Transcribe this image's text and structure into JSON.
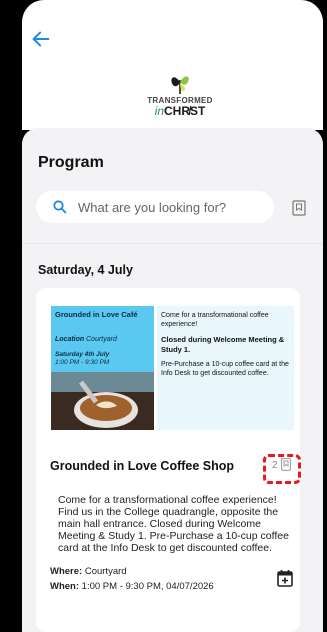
{
  "header": {
    "back_icon": "arrow-left-icon",
    "logo_line1": "TRANSFORMED",
    "logo_in": "in",
    "logo_line2": "CHR̸ST"
  },
  "program": {
    "title": "Program",
    "search_placeholder": "What are you looking for?",
    "date_heading": "Saturday, 4 July"
  },
  "event": {
    "promo": {
      "title": "Grounded in Love Café",
      "location_label": "Location",
      "location_value": "Courtyard",
      "date_label": "Saturday 4th July",
      "time": "1:00 PM - 9:30 PM",
      "text1": "Come for a transformational coffee experience!",
      "text2": "Closed during Welcome Meeting & Study 1.",
      "text3": "Pre-Purchase a 10-cup coffee card at the Info Desk to get discounted coffee."
    },
    "title": "Grounded in Love Coffee Shop",
    "bookmark_count": "2",
    "description": "Come for a transformational coffee experience! Find us in the College quadrangle, opposite the main hall entrance. Closed during Welcome Meeting & Study 1. Pre-Purchase a 10-cup coffee card at the Info Desk to get discounted coffee.",
    "where_label": "Where:",
    "where_value": "Courtyard",
    "when_label": "When:",
    "when_value": "1:00 PM - 9:30 PM, 04/07/2026"
  },
  "colors": {
    "accent": "#1e88e5",
    "promo_blue": "#5ac8f0",
    "highlight": "#e51b23"
  }
}
